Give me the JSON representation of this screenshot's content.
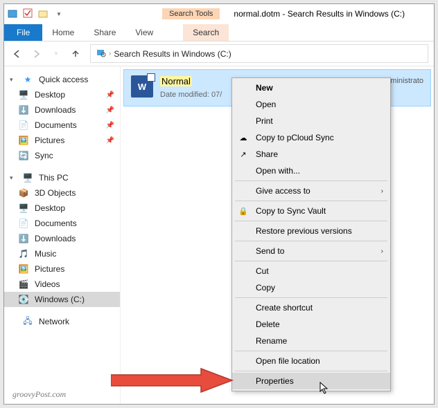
{
  "titlebar": {
    "contextual_tab": "Search Tools",
    "title": "normal.dotm - Search Results in Windows (C:)"
  },
  "ribbon": {
    "file": "File",
    "tabs": [
      "Home",
      "Share",
      "View"
    ],
    "search_tab": "Search"
  },
  "breadcrumb": {
    "text": "Search Results in Windows (C:)"
  },
  "sidebar": {
    "quick_access": "Quick access",
    "quick_items": [
      {
        "label": "Desktop",
        "icon": "🖥️",
        "pinned": true
      },
      {
        "label": "Downloads",
        "icon": "⬇️",
        "pinned": true
      },
      {
        "label": "Documents",
        "icon": "📄",
        "pinned": true
      },
      {
        "label": "Pictures",
        "icon": "🖼️",
        "pinned": true
      },
      {
        "label": "Sync",
        "icon": "🔄",
        "pinned": false
      }
    ],
    "this_pc": "This PC",
    "pc_items": [
      {
        "label": "3D Objects",
        "icon": "📦"
      },
      {
        "label": "Desktop",
        "icon": "🖥️"
      },
      {
        "label": "Documents",
        "icon": "📄"
      },
      {
        "label": "Downloads",
        "icon": "⬇️"
      },
      {
        "label": "Music",
        "icon": "🎵"
      },
      {
        "label": "Pictures",
        "icon": "🖼️"
      },
      {
        "label": "Videos",
        "icon": "🎬"
      },
      {
        "label": "Windows (C:)",
        "icon": "💽",
        "selected": true
      }
    ],
    "network": "Network"
  },
  "file_result": {
    "icon_letter": "W",
    "name": "Normal",
    "sub_prefix": "Date modified: ",
    "date": "07/",
    "path": "C:\\Users\\Administrato"
  },
  "context_menu": {
    "items": [
      {
        "label": "New",
        "bold": true
      },
      {
        "label": "Open"
      },
      {
        "label": "Print"
      },
      {
        "label": "Copy to pCloud Sync",
        "icon": "☁"
      },
      {
        "label": "Share",
        "icon": "↗"
      },
      {
        "label": "Open with..."
      },
      {
        "sep": true
      },
      {
        "label": "Give access to",
        "submenu": true
      },
      {
        "sep": true
      },
      {
        "label": "Copy to Sync Vault",
        "icon": "🔒"
      },
      {
        "sep": true
      },
      {
        "label": "Restore previous versions"
      },
      {
        "sep": true
      },
      {
        "label": "Send to",
        "submenu": true
      },
      {
        "sep": true
      },
      {
        "label": "Cut"
      },
      {
        "label": "Copy"
      },
      {
        "sep": true
      },
      {
        "label": "Create shortcut"
      },
      {
        "label": "Delete"
      },
      {
        "label": "Rename"
      },
      {
        "sep": true
      },
      {
        "label": "Open file location"
      },
      {
        "sep": true
      },
      {
        "label": "Properties",
        "hover": true
      }
    ]
  },
  "watermark": "groovyPost.com"
}
